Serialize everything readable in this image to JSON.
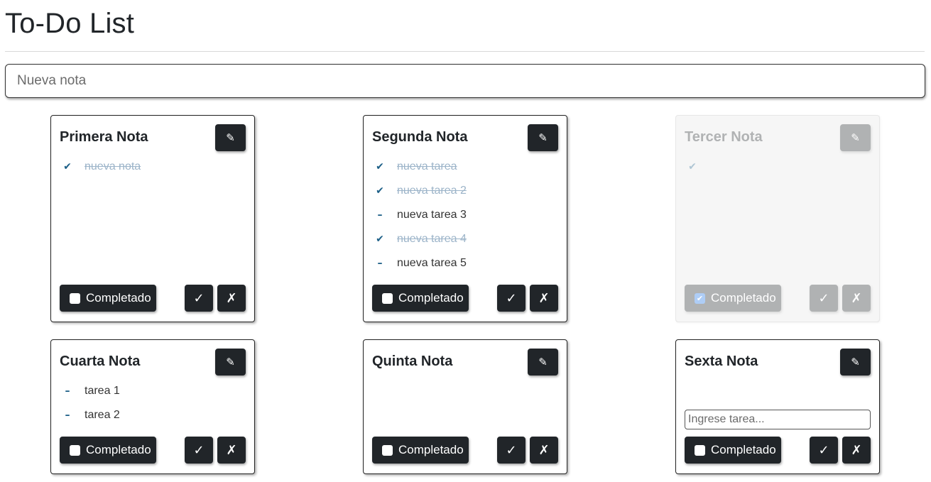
{
  "app": {
    "title": "To-Do List",
    "new_note": {
      "placeholder": "Nueva nota",
      "value": ""
    }
  },
  "icons": {
    "edit": "✎",
    "done_marker": "✔",
    "pending_marker": "–",
    "confirm": "✓",
    "cancel": "✗",
    "checkbox_check": "✔"
  },
  "colors": {
    "button_dark": "#212529",
    "task_marker": "#1c5f87",
    "done_text": "#9cb4c9",
    "checkbox_checked": "#1a73e8"
  },
  "labels": {
    "completed": "Completado"
  },
  "notes": [
    {
      "title": "Primera Nota",
      "completed": false,
      "tasks": [
        {
          "text": "nueva nota",
          "done": true
        }
      ]
    },
    {
      "title": "Segunda Nota",
      "completed": false,
      "tasks": [
        {
          "text": "nueva tarea",
          "done": true
        },
        {
          "text": "nueva tarea 2",
          "done": true
        },
        {
          "text": "nueva tarea 3",
          "done": false
        },
        {
          "text": "nueva tarea 4",
          "done": true
        },
        {
          "text": "nueva tarea 5",
          "done": false
        }
      ]
    },
    {
      "title": "Tercer Nota",
      "completed": true,
      "tasks": [
        {
          "text": "",
          "done": true
        }
      ]
    },
    {
      "title": "Cuarta Nota",
      "completed": false,
      "tasks": [
        {
          "text": "tarea 1",
          "done": false
        },
        {
          "text": "tarea 2",
          "done": false
        }
      ]
    },
    {
      "title": "Quinta Nota",
      "completed": false,
      "tasks": []
    },
    {
      "title": "Sexta Nota",
      "completed": false,
      "tasks": [],
      "task_input": {
        "placeholder": "Ingrese tarea...",
        "value": ""
      }
    }
  ]
}
